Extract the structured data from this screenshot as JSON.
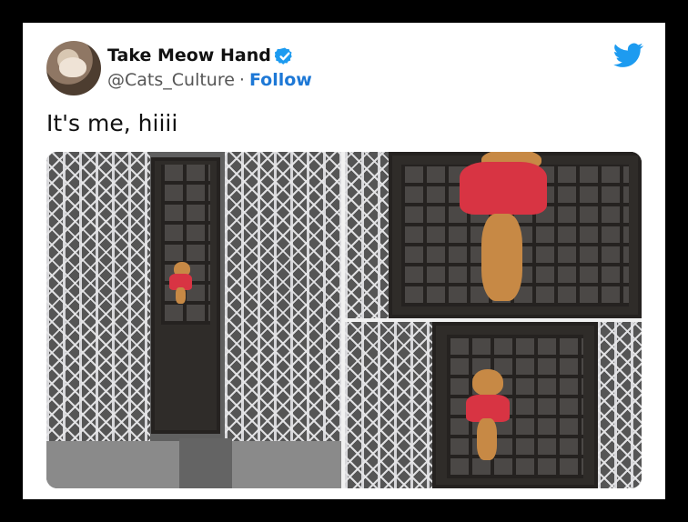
{
  "tweet": {
    "display_name": "Take Meow Hand",
    "handle": "@Cats_Culture",
    "separator": "·",
    "follow_label": "Follow",
    "text": "It's me, hiiii"
  },
  "icons": {
    "verified": "verified-badge-icon",
    "platform": "twitter-bird-icon"
  },
  "colors": {
    "background": "#000000",
    "card": "#ffffff",
    "follow_blue": "#1d78d6",
    "verified_blue": "#1d9bf0",
    "twitter_blue": "#1d9bf0"
  }
}
